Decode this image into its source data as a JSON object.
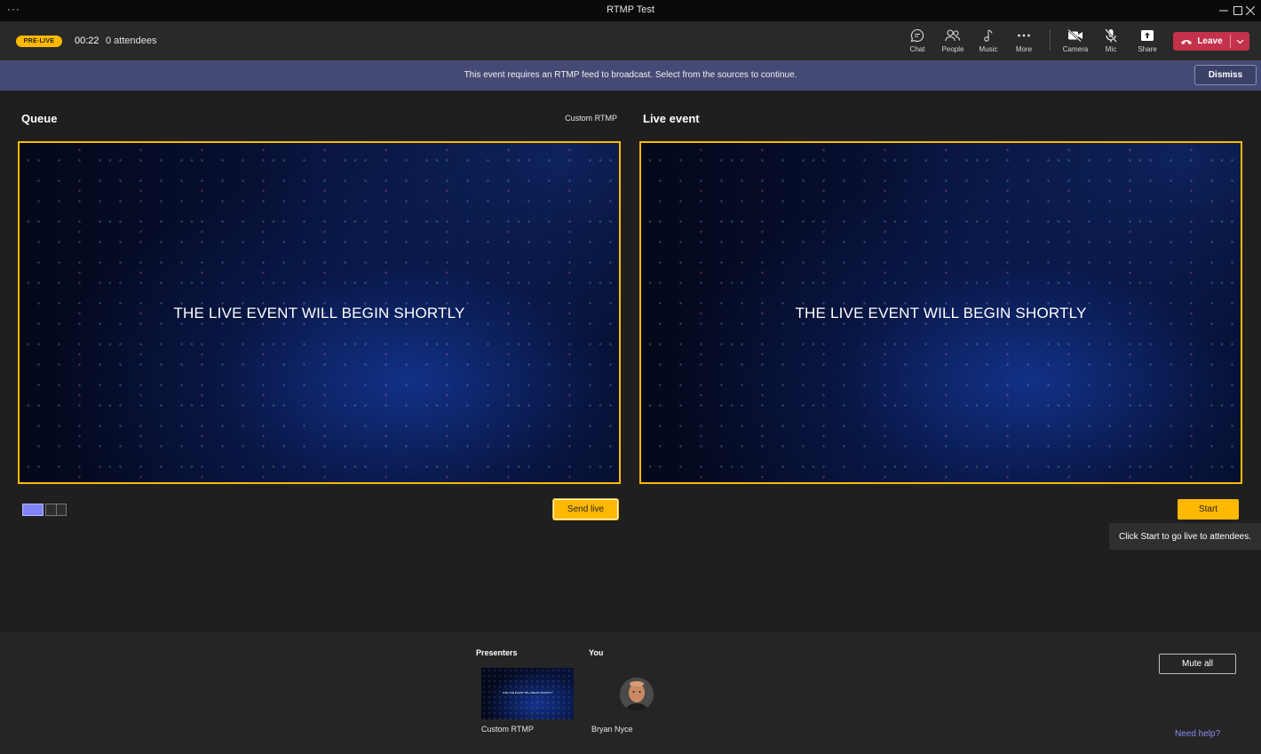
{
  "window": {
    "title": "RTMP Test",
    "menu_glyph": "···"
  },
  "toolbar": {
    "status_badge": "PRE-LIVE",
    "timer": "00:22",
    "attendees": "0 attendees",
    "buttons": [
      {
        "label": "Chat",
        "icon": "chat-icon"
      },
      {
        "label": "People",
        "icon": "people-icon"
      },
      {
        "label": "Music",
        "icon": "music-icon"
      },
      {
        "label": "More",
        "icon": "more-icon"
      },
      {
        "label": "Camera",
        "icon": "camera-off-icon"
      },
      {
        "label": "Mic",
        "icon": "mic-off-icon"
      },
      {
        "label": "Share",
        "icon": "share-icon"
      }
    ],
    "leave_label": "Leave"
  },
  "banner": {
    "message": "This event requires an RTMP feed to broadcast. Select from the sources to continue.",
    "dismiss_label": "Dismiss"
  },
  "queue": {
    "title": "Queue",
    "source_label": "Custom RTMP",
    "caption": "THE LIVE EVENT WILL BEGIN SHORTLY",
    "send_live_label": "Send live"
  },
  "live": {
    "title": "Live event",
    "caption": "THE LIVE EVENT WILL BEGIN SHORTLY",
    "start_label": "Start",
    "tooltip": "Click Start to go live to attendees."
  },
  "bottom": {
    "presenters_title": "Presenters",
    "you_title": "You",
    "presenter_name": "Custom RTMP",
    "presenter_thumb_caption": "THE LIVE EVENT WILL BEGIN SHORTLY",
    "you_name": "Bryan Nyce",
    "mute_all_label": "Mute all",
    "need_help_label": "Need help?"
  },
  "colors": {
    "accent_yellow": "#ffb900",
    "leave_red": "#c4314b",
    "banner_bg": "#444a74",
    "link_purple": "#8b8cf0"
  }
}
